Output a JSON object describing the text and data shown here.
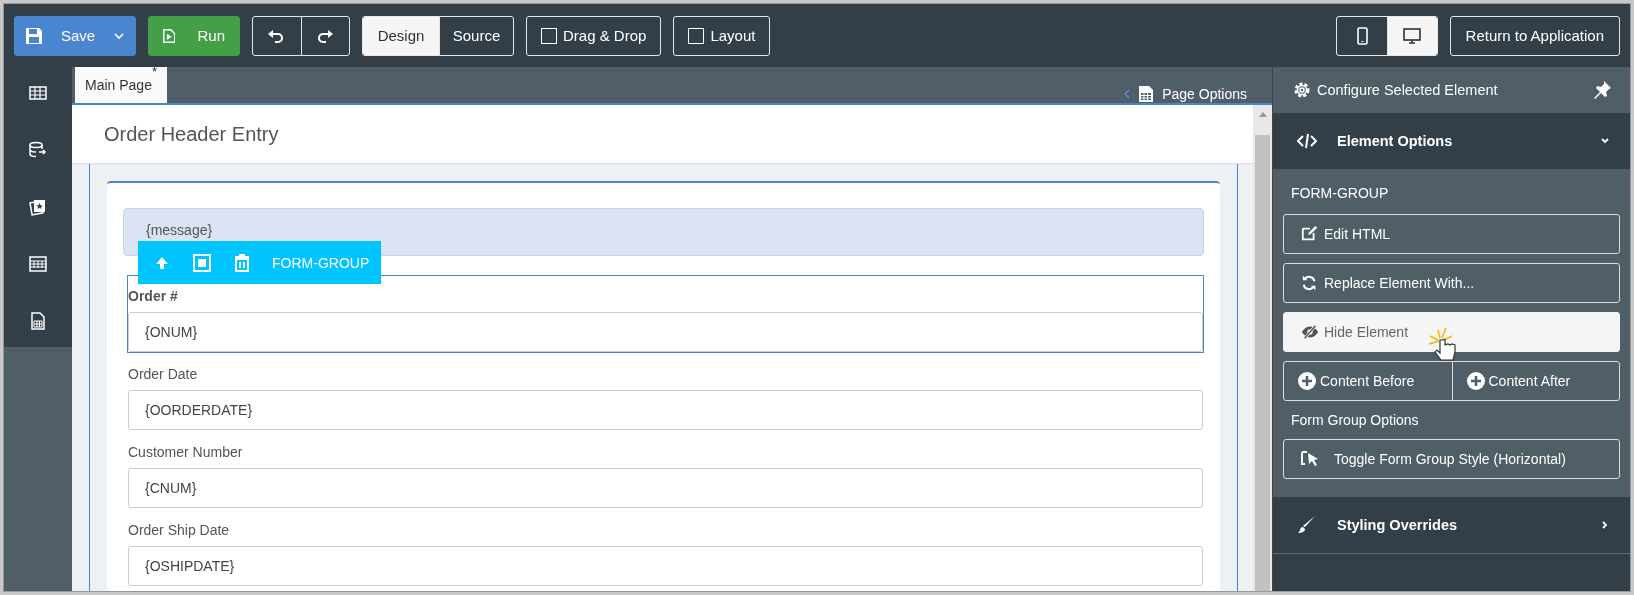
{
  "toolbar": {
    "save": "Save",
    "run": "Run",
    "view_modes": [
      {
        "label": "Design",
        "selected": true
      },
      {
        "label": "Source",
        "selected": false
      }
    ],
    "toggles": [
      {
        "label": "Drag & Drop",
        "checked": false
      },
      {
        "label": "Layout",
        "checked": false
      }
    ],
    "devices": [
      {
        "kind": "mobile",
        "selected": false
      },
      {
        "kind": "desktop",
        "selected": true
      }
    ],
    "return": "Return to Application"
  },
  "sidebar": {
    "items": [
      {
        "kind": "table"
      },
      {
        "kind": "database"
      },
      {
        "kind": "gallery"
      },
      {
        "kind": "grid"
      },
      {
        "kind": "sheet"
      }
    ]
  },
  "page_tab": {
    "label": "Main Page",
    "modified_mark": "*"
  },
  "page_options": "Page Options",
  "page_title": "Order Header Entry",
  "message": "{message}",
  "element_toolbar": {
    "label": "FORM-GROUP"
  },
  "form_groups": [
    {
      "label": "Order #",
      "value": "{ONUM}",
      "selected": true
    },
    {
      "label": "Order Date",
      "value": "{OORDERDATE}",
      "selected": false
    },
    {
      "label": "Customer Number",
      "value": "{CNUM}",
      "selected": false
    },
    {
      "label": "Order Ship Date",
      "value": "{OSHIPDATE}",
      "selected": false
    }
  ],
  "panel": {
    "title": "Configure Selected Element",
    "sections": [
      {
        "kind": "code",
        "title": "Element Options",
        "expanded": true
      },
      {
        "kind": "brush",
        "title": "Styling Overrides",
        "expanded": false
      }
    ],
    "element_type": "FORM-GROUP",
    "actions": [
      {
        "kind": "edit",
        "label": "Edit HTML",
        "hovered": false
      },
      {
        "kind": "refresh",
        "label": "Replace Element With...",
        "hovered": false
      },
      {
        "kind": "hide",
        "label": "Hide Element",
        "hovered": true
      }
    ],
    "pair": [
      {
        "label": "Content Before"
      },
      {
        "label": "Content After"
      }
    ],
    "options_title": "Form Group Options",
    "toggle": "Toggle Form Group Style (Horizontal)"
  }
}
